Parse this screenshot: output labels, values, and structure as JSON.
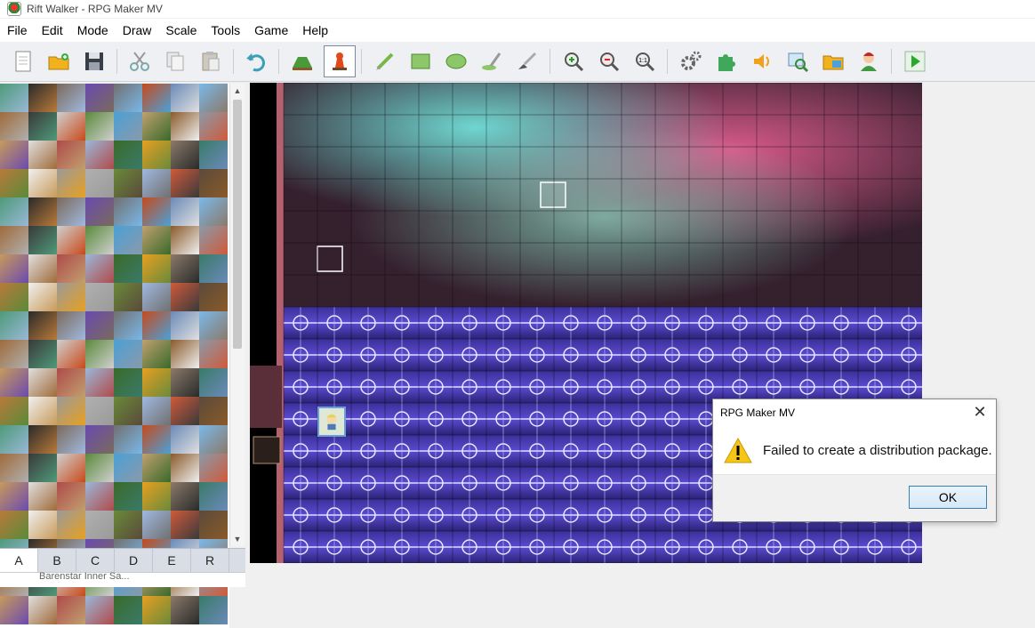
{
  "window": {
    "title": "Rift Walker - RPG Maker MV"
  },
  "menu": [
    "File",
    "Edit",
    "Mode",
    "Draw",
    "Scale",
    "Tools",
    "Game",
    "Help"
  ],
  "toolbar": {
    "buttons": [
      "new-project",
      "open-project",
      "save-project",
      "cut",
      "copy",
      "paste",
      "undo",
      "map-mode",
      "event-mode",
      "pencil",
      "rectangle",
      "ellipse",
      "flood-fill",
      "shadow-pen",
      "zoom-in",
      "zoom-out",
      "zoom-actual",
      "database",
      "plugin-manager",
      "sound-test",
      "event-searcher",
      "resource-manager",
      "character-generator",
      "playtest"
    ]
  },
  "tileset": {
    "tabs": [
      "A",
      "B",
      "C",
      "D",
      "E",
      "R"
    ],
    "active_tab": "A",
    "map_tree_text": "Barenstar Inner Sa..."
  },
  "dialog": {
    "title": "RPG Maker MV",
    "message": "Failed to create a distribution package.",
    "ok_label": "OK"
  }
}
